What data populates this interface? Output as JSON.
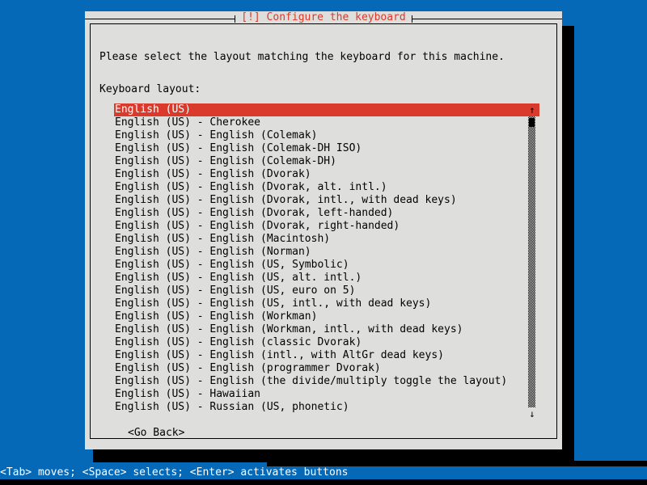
{
  "window": {
    "title": "[!] Configure the keyboard",
    "title_color": "#d93a2b",
    "frame_color": "#dededc",
    "background_color": "#0569b8"
  },
  "content": {
    "prompt": "Please select the layout matching the keyboard for this machine.",
    "field_label": "Keyboard layout:"
  },
  "list": {
    "selected_index": 0,
    "selection_color": "#d93a2b",
    "items": [
      "English (US)",
      "English (US) - Cherokee",
      "English (US) - English (Colemak)",
      "English (US) - English (Colemak-DH ISO)",
      "English (US) - English (Colemak-DH)",
      "English (US) - English (Dvorak)",
      "English (US) - English (Dvorak, alt. intl.)",
      "English (US) - English (Dvorak, intl., with dead keys)",
      "English (US) - English (Dvorak, left-handed)",
      "English (US) - English (Dvorak, right-handed)",
      "English (US) - English (Macintosh)",
      "English (US) - English (Norman)",
      "English (US) - English (US, Symbolic)",
      "English (US) - English (US, alt. intl.)",
      "English (US) - English (US, euro on 5)",
      "English (US) - English (US, intl., with dead keys)",
      "English (US) - English (Workman)",
      "English (US) - English (Workman, intl., with dead keys)",
      "English (US) - English (classic Dvorak)",
      "English (US) - English (intl., with AltGr dead keys)",
      "English (US) - English (programmer Dvorak)",
      "English (US) - English (the divide/multiply toggle the layout)",
      "English (US) - Hawaiian",
      "English (US) - Russian (US, phonetic)"
    ]
  },
  "scrollbar": {
    "up_arrow": "↑",
    "down_arrow": "↓"
  },
  "buttons": {
    "go_back": "<Go Back>"
  },
  "statusbar": {
    "text": "<Tab> moves; <Space> selects; <Enter> activates buttons",
    "background_color": "#0569b8",
    "text_color": "#ffffff"
  }
}
